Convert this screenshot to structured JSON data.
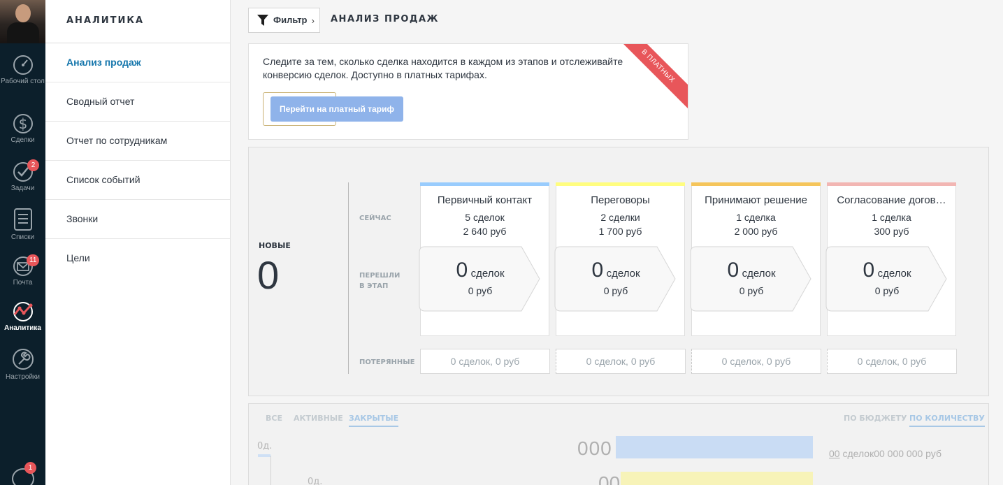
{
  "sidebar": {
    "items": [
      {
        "label": "Рабочий стол",
        "icon": "dashboard-icon"
      },
      {
        "label": "Сделки",
        "icon": "dollar-icon"
      },
      {
        "label": "Задачи",
        "icon": "checkmark-icon",
        "badge": "2"
      },
      {
        "label": "Списки",
        "icon": "list-icon"
      },
      {
        "label": "Почта",
        "icon": "mail-icon",
        "badge": "11"
      },
      {
        "label": "Аналитика",
        "icon": "analytics-icon",
        "active": true
      },
      {
        "label": "Настройки",
        "icon": "wrench-icon"
      }
    ],
    "bottom_badge": "1"
  },
  "submenu": {
    "title": "АНАЛИТИКА",
    "items": [
      "Анализ продаж",
      "Сводный отчет",
      "Отчет по сотрудникам",
      "Список событий",
      "Звонки",
      "Цели"
    ],
    "active_index": 0
  },
  "header": {
    "filter_label": "Фильтр",
    "page_title": "АНАЛИЗ ПРОДАЖ"
  },
  "promo": {
    "text": "Следите за тем, сколько сделка находится в каждом из этапов и отслеживайте конверсию сделок. Доступно в платных тарифах.",
    "button": "Перейти на платный тариф",
    "ribbon": "В ПЛАТНЫХ"
  },
  "funnel": {
    "new_label": "НОВЫЕ",
    "new_value": "0",
    "row_now": "СЕЙЧАС",
    "row_moved_1": "ПЕРЕШЛИ",
    "row_moved_2": "В ЭТАП",
    "row_lost": "ПОТЕРЯННЫЕ",
    "stages": [
      {
        "name": "Первичный контакт",
        "count": "5 сделок",
        "sum": "2 640 руб",
        "moved_n": "0",
        "moved_unit": "сделок",
        "moved_sum": "0 руб",
        "lost": "0 сделок, 0 руб",
        "color": "#99ccfd"
      },
      {
        "name": "Переговоры",
        "count": "2 сделки",
        "sum": "1 700 руб",
        "moved_n": "0",
        "moved_unit": "сделок",
        "moved_sum": "0 руб",
        "lost": "0 сделок, 0 руб",
        "color": "#fffd7f"
      },
      {
        "name": "Принимают решение",
        "count": "1 сделка",
        "sum": "2 000 руб",
        "moved_n": "0",
        "moved_unit": "сделок",
        "moved_sum": "0 руб",
        "lost": "0 сделок, 0 руб",
        "color": "#fff000"
      },
      {
        "name": "Согласование догов…",
        "count": "1 сделка",
        "sum": "300 руб",
        "moved_n": "0",
        "moved_unit": "сделок",
        "moved_sum": "0 руб",
        "lost": "0 сделок, 0 руб",
        "color": "#f2b6b3"
      }
    ]
  },
  "bottom": {
    "tabs": [
      "ВСЕ",
      "АКТИВНЫЕ",
      "ЗАКРЫТЫЕ"
    ],
    "active_tab": 2,
    "modes": [
      "ПО БЮДЖЕТУ",
      "ПО КОЛИЧЕСТВУ"
    ],
    "active_mode": 1,
    "axis_top": "0д.",
    "axis_second": "0д.",
    "bar1_value": "000",
    "bar2_value": "00",
    "summary_link": "00",
    "summary_text": " сделок00 000 000 руб"
  }
}
